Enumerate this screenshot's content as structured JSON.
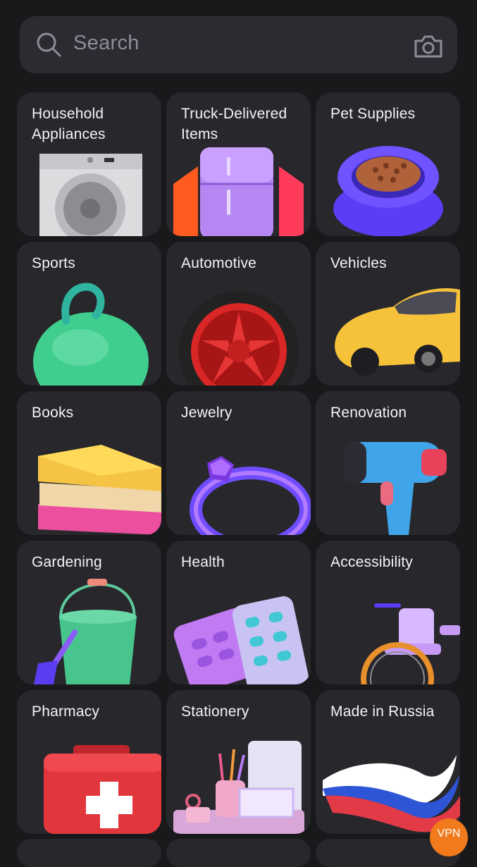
{
  "search": {
    "placeholder": "Search",
    "icon": "search-icon",
    "camera_icon": "camera-icon"
  },
  "categories": [
    {
      "label": "Household Appliances",
      "image": "washing-machine"
    },
    {
      "label": "Truck-Delivered Items",
      "image": "refrigerator"
    },
    {
      "label": "Pet Supplies",
      "image": "pet-food-bowl"
    },
    {
      "label": "Sports",
      "image": "kettlebell-ball"
    },
    {
      "label": "Automotive",
      "image": "car-wheel"
    },
    {
      "label": "Vehicles",
      "image": "sports-car"
    },
    {
      "label": "Books",
      "image": "book-stack"
    },
    {
      "label": "Jewelry",
      "image": "gem-ring"
    },
    {
      "label": "Renovation",
      "image": "power-drill"
    },
    {
      "label": "Gardening",
      "image": "bucket-and-shovel"
    },
    {
      "label": "Health",
      "image": "pill-blisters"
    },
    {
      "label": "Accessibility",
      "image": "wheelchair"
    },
    {
      "label": "Pharmacy",
      "image": "first-aid-kit"
    },
    {
      "label": "Stationery",
      "image": "desk-organizer"
    },
    {
      "label": "Made in Russia",
      "image": "russian-flag-ribbon"
    }
  ],
  "vpn_badge": "VPN",
  "colors": {
    "background": "#19191b",
    "tile": "#27272c",
    "search_bg": "#2b2b31",
    "vpn": "#f07a1c"
  }
}
